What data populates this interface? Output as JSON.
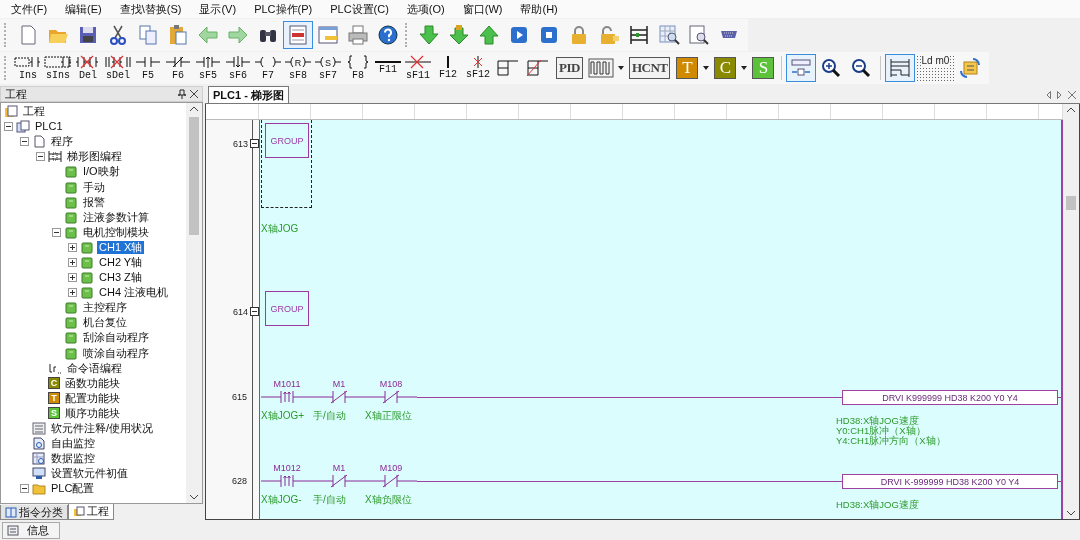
{
  "menu": [
    {
      "label": "文件(F)"
    },
    {
      "label": "编辑(E)"
    },
    {
      "label": "查找\\替换(S)"
    },
    {
      "label": "显示(V)"
    },
    {
      "label": "PLC操作(P)"
    },
    {
      "label": "PLC设置(C)"
    },
    {
      "label": "选项(O)"
    },
    {
      "label": "窗口(W)"
    },
    {
      "label": "帮助(H)"
    }
  ],
  "toolbar_main": [
    {
      "kind": "new",
      "selected": false
    },
    {
      "kind": "open",
      "selected": false
    },
    {
      "kind": "save",
      "selected": false
    },
    {
      "kind": "cut",
      "selected": false
    },
    {
      "kind": "copy",
      "selected": false
    },
    {
      "kind": "paste",
      "selected": false
    },
    {
      "kind": "back",
      "selected": false
    },
    {
      "kind": "forward",
      "selected": false
    },
    {
      "kind": "find",
      "selected": false
    },
    {
      "kind": "view",
      "selected": true
    },
    {
      "kind": "window",
      "selected": false
    },
    {
      "kind": "print",
      "selected": false
    },
    {
      "kind": "help",
      "selected": false
    },
    {
      "kind": "separator"
    },
    {
      "kind": "download",
      "selected": false
    },
    {
      "kind": "download-lock",
      "selected": false
    },
    {
      "kind": "upload",
      "selected": false
    },
    {
      "kind": "run",
      "selected": false
    },
    {
      "kind": "stop",
      "selected": false
    },
    {
      "kind": "lock",
      "selected": false
    },
    {
      "kind": "unlock",
      "selected": false
    },
    {
      "kind": "monitor",
      "selected": false
    },
    {
      "kind": "table-search",
      "selected": false
    },
    {
      "kind": "doc-search",
      "selected": false
    },
    {
      "kind": "port",
      "selected": false
    }
  ],
  "toolbar_ladder": [
    {
      "kind": "ins",
      "label": "Ins"
    },
    {
      "kind": "sins",
      "label": "sIns"
    },
    {
      "kind": "del",
      "label": "Del"
    },
    {
      "kind": "sdel",
      "label": "sDel"
    },
    {
      "kind": "no",
      "label": "F5"
    },
    {
      "kind": "nc",
      "label": "F6"
    },
    {
      "kind": "rise",
      "label": "sF5"
    },
    {
      "kind": "fall",
      "label": "sF6"
    },
    {
      "kind": "coil",
      "label": "F7"
    },
    {
      "kind": "coil",
      "letter": "R",
      "label": "sF8"
    },
    {
      "kind": "coil",
      "letter": "S",
      "label": "sF7"
    },
    {
      "kind": "func",
      "label": "F8"
    },
    {
      "kind": "hline",
      "label": "F11"
    },
    {
      "kind": "hline-del",
      "label": "sF11"
    },
    {
      "kind": "vline",
      "label": "F12"
    },
    {
      "kind": "vline-del",
      "label": "sF12"
    },
    {
      "kind": "block"
    },
    {
      "kind": "block-del"
    }
  ],
  "toolbar_tools": [
    {
      "kind": "boxed",
      "label": "PID",
      "selected": false
    },
    {
      "kind": "pulse",
      "dropdown": true,
      "selected": false
    },
    {
      "kind": "boxed",
      "label": "HCNT",
      "selected": false
    },
    {
      "kind": "letter",
      "label": "T",
      "color": "#d08a00",
      "dropdown": true,
      "selected": false
    },
    {
      "kind": "letter",
      "label": "C",
      "color": "#8a8a00",
      "dropdown": true,
      "selected": false
    },
    {
      "kind": "letter",
      "label": "S",
      "color": "#5cc23a",
      "selected": false
    },
    {
      "kind": "separator"
    },
    {
      "kind": "split",
      "selected": true
    },
    {
      "kind": "zoom-in",
      "selected": false
    },
    {
      "kind": "zoom-out",
      "selected": false
    },
    {
      "kind": "separator"
    },
    {
      "kind": "ladder",
      "selected": true
    },
    {
      "kind": "ld",
      "label": "Ld m0",
      "selected": false
    },
    {
      "kind": "convert",
      "selected": false
    }
  ],
  "project_panel": {
    "title": "工程",
    "tree": [
      {
        "label": "工程",
        "kind": "project",
        "selected": false,
        "children": [
          {
            "label": "PLC1",
            "kind": "plc",
            "selected": false,
            "expanded": true,
            "children": [
              {
                "label": "程序",
                "kind": "doc",
                "selected": false,
                "expanded": true,
                "children": [
                  {
                    "label": "梯形图编程",
                    "kind": "ladder",
                    "selected": false,
                    "expanded": true,
                    "children": [
                      {
                        "label": "I/O映射",
                        "kind": "block",
                        "selected": false
                      },
                      {
                        "label": "手动",
                        "kind": "block",
                        "selected": false
                      },
                      {
                        "label": "报警",
                        "kind": "block",
                        "selected": false
                      },
                      {
                        "label": "注液参数计算",
                        "kind": "block",
                        "selected": false
                      },
                      {
                        "label": "电机控制模块",
                        "kind": "block",
                        "selected": false,
                        "expanded": true,
                        "children": [
                          {
                            "label": "CH1 X轴",
                            "kind": "block",
                            "selected": true,
                            "expanded": false
                          },
                          {
                            "label": "CH2 Y轴",
                            "kind": "block",
                            "selected": false,
                            "expanded": false
                          },
                          {
                            "label": "CH3 Z轴",
                            "kind": "block",
                            "selected": false,
                            "expanded": false
                          },
                          {
                            "label": "CH4 注液电机",
                            "kind": "block",
                            "selected": false,
                            "expanded": false
                          }
                        ]
                      },
                      {
                        "label": "主控程序",
                        "kind": "block",
                        "selected": false
                      },
                      {
                        "label": "机台复位",
                        "kind": "block",
                        "selected": false
                      },
                      {
                        "label": "刮涂自动程序",
                        "kind": "block",
                        "selected": false
                      },
                      {
                        "label": "喷涂自动程序",
                        "kind": "block",
                        "selected": false
                      }
                    ]
                  },
                  {
                    "label": "命令语编程",
                    "kind": "ld",
                    "selected": false
                  },
                  {
                    "label": "函数功能块",
                    "kind": "letter",
                    "badge": "C",
                    "color": "#8a8a00",
                    "selected": false
                  },
                  {
                    "label": "配置功能块",
                    "kind": "letter",
                    "badge": "T",
                    "color": "#d08a00",
                    "selected": false
                  },
                  {
                    "label": "顺序功能块",
                    "kind": "letter",
                    "badge": "S",
                    "color": "#5cc23a",
                    "selected": false
                  }
                ]
              },
              {
                "label": "软元件注释/使用状况",
                "kind": "list",
                "selected": false
              },
              {
                "label": "自由监控",
                "kind": "monitor",
                "selected": false
              },
              {
                "label": "数据监控",
                "kind": "data",
                "selected": false
              },
              {
                "label": "设置软元件初值",
                "kind": "settings",
                "selected": false
              },
              {
                "label": "PLC配置",
                "kind": "folder",
                "selected": false,
                "expanded": true
              }
            ]
          }
        ]
      }
    ],
    "tabs": [
      {
        "label": "指令分类",
        "selected": false
      },
      {
        "label": "工程",
        "selected": true
      }
    ]
  },
  "info_tab": {
    "label": "信息"
  },
  "editor": {
    "tabs": [
      {
        "label": "PLC1 - 梯形图",
        "selected": true
      }
    ],
    "rungs": [
      {
        "number": "613",
        "kind": "group",
        "label": "GROUP",
        "comment": "X轴JOG",
        "selected": true
      },
      {
        "number": "614",
        "kind": "group",
        "label": "GROUP",
        "selected": false
      },
      {
        "number": "615",
        "kind": "logic",
        "selected": false,
        "contacts": [
          {
            "address": "M1011",
            "kind": "rise",
            "comment": "X轴JOG+"
          },
          {
            "address": "M1",
            "kind": "nc",
            "comment": "手/自动"
          },
          {
            "address": "M108",
            "kind": "nc",
            "comment": "X轴正限位"
          }
        ],
        "output": "DRVI K999999 HD38 K200 Y0 Y4",
        "notes": [
          "HD38:X轴JOG速度",
          "Y0:CH1脉冲（X轴）",
          "Y4:CH1脉冲方向（X轴）"
        ]
      },
      {
        "number": "628",
        "kind": "logic",
        "selected": false,
        "contacts": [
          {
            "address": "M1012",
            "kind": "rise",
            "comment": "X轴JOG-"
          },
          {
            "address": "M1",
            "kind": "nc",
            "comment": "手/自动"
          },
          {
            "address": "M109",
            "kind": "nc",
            "comment": "X轴负限位"
          }
        ],
        "output": "DRVI K-999999 HD38 K200 Y0 Y4",
        "notes": [
          "HD38:X轴JOG速度"
        ]
      }
    ]
  }
}
